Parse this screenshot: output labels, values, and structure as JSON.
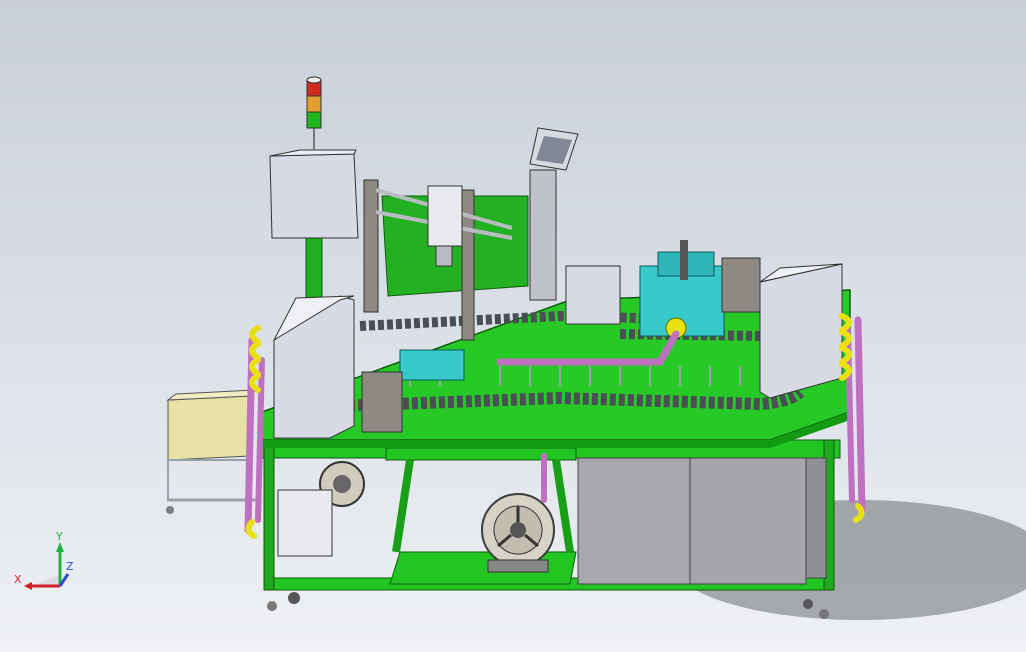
{
  "viewport": {
    "background_top": "#c9cfd9",
    "background_bottom": "#eef0f3"
  },
  "triad": {
    "x_label": "X",
    "y_label": "Y",
    "z_label": "Z",
    "x_color": "#d4202a",
    "y_color": "#23b23f",
    "z_color": "#2a4fd6"
  },
  "palette": {
    "frame_green": "#20c020",
    "frame_dark": "#127a12",
    "cover_gray": "#d9dbe6",
    "panel_gray": "#a9a9ac",
    "cyan_block": "#35c9c9",
    "pink_pipe": "#c070c0",
    "yellow_fitting": "#e8e010",
    "steel": "#8a8e96"
  },
  "model_parts": [
    "signal-tower-icon",
    "control-box-icon",
    "green-frame-table-icon",
    "conveyor-chain-icon",
    "blower-fan-icon",
    "gray-cabinet-icon",
    "pink-air-pipes-icon",
    "parts-tray-icon",
    "monitor-arm-icon"
  ]
}
